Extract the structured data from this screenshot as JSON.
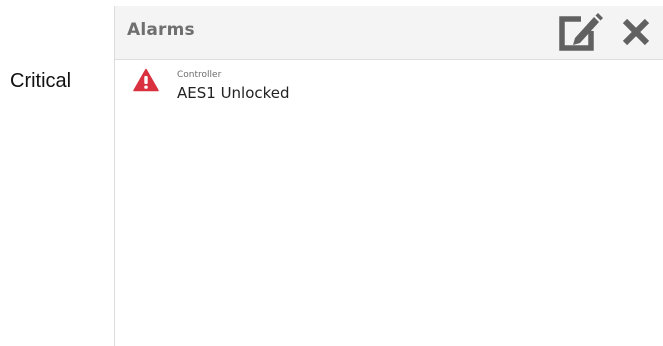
{
  "severity_label": "Critical",
  "panel": {
    "title": "Alarms",
    "edit_icon": "edit-icon",
    "close_icon": "close-icon"
  },
  "alarms": [
    {
      "source": "Controller",
      "message": "AES1 Unlocked",
      "icon": "warning-triangle-icon",
      "icon_color": "#d9313f"
    }
  ],
  "colors": {
    "header_bg": "#f4f4f4",
    "header_icon": "#616161",
    "title_text": "#6f6f6f",
    "critical": "#d9313f"
  }
}
